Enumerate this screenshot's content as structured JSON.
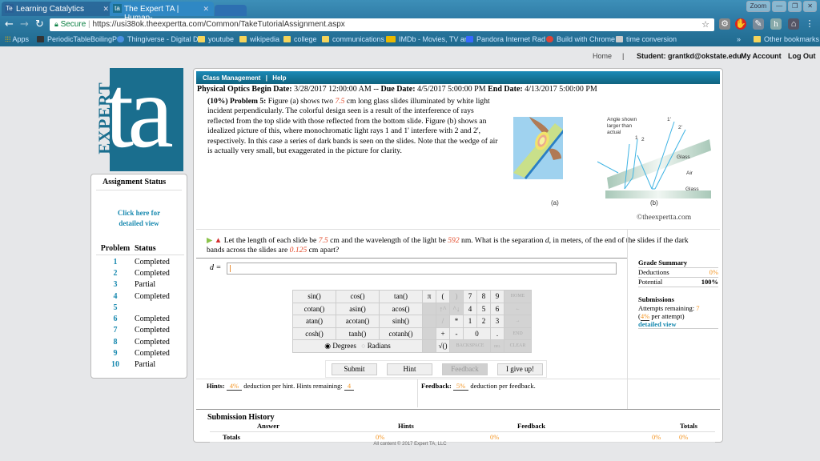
{
  "browser": {
    "tabs": [
      {
        "icon": "Te",
        "label": "Learning Catalytics"
      },
      {
        "icon": "ta",
        "label": "The Expert TA | Human-"
      }
    ],
    "window_controls": [
      "Zoom",
      "—",
      "❐",
      "✕"
    ],
    "url_secure_label": "Secure",
    "url": "https://usi38ok.theexpertta.com/Common/TakeTutorialAssignment.aspx",
    "bookmarks": [
      "Apps",
      "PeriodicTableBoilingP",
      "Thingiverse - Digital D",
      "youtube",
      "wikipedia",
      "college",
      "communications",
      "IMDb - Movies, TV an",
      "Pandora Internet Rad",
      "Build with Chrome",
      "time conversion"
    ],
    "overflow": "»",
    "other_bookmarks": "Other bookmarks"
  },
  "topnav": {
    "home": "Home",
    "sep": "|",
    "student": "Student: grantkd@okstate.edu",
    "account": "My Account",
    "logout": "Log Out"
  },
  "logo": {
    "word": "EXPERT",
    "mark": "ta"
  },
  "sidebar": {
    "title": "Assignment Status",
    "detail_link_1": "Click here for",
    "detail_link_2": "detailed view",
    "col_problem": "Problem",
    "col_status": "Status",
    "problems": [
      {
        "n": "1",
        "status": "Completed"
      },
      {
        "n": "2",
        "status": "Completed"
      },
      {
        "n": "3",
        "status": "Partial"
      },
      {
        "n": "4",
        "status": "Completed"
      },
      {
        "n": "5",
        "status": ""
      },
      {
        "n": "6",
        "status": "Completed"
      },
      {
        "n": "7",
        "status": "Completed"
      },
      {
        "n": "8",
        "status": "Completed"
      },
      {
        "n": "9",
        "status": "Completed"
      },
      {
        "n": "10",
        "status": "Partial"
      }
    ]
  },
  "menubar": {
    "class_mgmt": "Class Management",
    "sep": "|",
    "help": "Help"
  },
  "assignment": {
    "name": "Physical Optics",
    "begin_label": "Begin Date:",
    "begin": "3/28/2017 12:00:00 AM",
    "dash": "--",
    "due_label": "Due Date:",
    "due": "4/5/2017 5:00:00 PM",
    "end_label": "End Date:",
    "end": "4/13/2017 5:00:00 PM"
  },
  "problem": {
    "heading": "(10%) Problem 5:",
    "text_1": "Figure (a) shows two",
    "length": "7.5",
    "text_2": "cm long glass slides illuminated by white light incident perpendicularly. The colorful design seen is a result of the interference of rays reflected from the top slide with those reflected from the bottom slide. Figure (b) shows an idealized picture of this, where monochromatic light rays 1 and 1' interfere with 2 and 2', respectively. In this case a series of dark bands is seen on the slides. Note that the wedge of air is actually very small, but exaggerated in the picture for clarity.",
    "fig_a_label": "(a)",
    "fig_b_label": "(b)",
    "fig_b_note": "Angle shown larger than actual",
    "fig_b_rays": [
      "1",
      "2",
      "1'",
      "2'"
    ],
    "fig_b_glass": "Glass",
    "fig_b_air": "Air",
    "copyright": "©theexpertta.com"
  },
  "question": {
    "t1": "Let the length of each slide be",
    "length": "7.5",
    "t2": "cm and the wavelength of the light be",
    "wavelength": "592",
    "t3": "nm. What is the separation",
    "var": "d",
    "t4": ", in meters, of the end of the slides if the dark bands across the slides are",
    "spacing": "0.125",
    "t5": "cm apart?",
    "answer_label": "d =",
    "answer_value": ""
  },
  "grade": {
    "title": "Grade Summary",
    "deductions_label": "Deductions",
    "deductions": "0%",
    "potential_label": "Potential",
    "potential": "100%",
    "submissions_title": "Submissions",
    "attempts_label": "Attempts remaining:",
    "attempts": "7",
    "per_attempt_pct": "4%",
    "per_attempt_text": "per attempt)",
    "detail": "detailed view"
  },
  "keypad": {
    "functions": [
      [
        "sin()",
        "cos()",
        "tan()"
      ],
      [
        "cotan()",
        "asin()",
        "acos()"
      ],
      [
        "atan()",
        "acotan()",
        "sinh()"
      ],
      [
        "cosh()",
        "tanh()",
        "cotanh()"
      ]
    ],
    "pi": "π",
    "lparen": "(",
    "rparen": ")",
    "up": "↑^",
    "down": "^↓",
    "slash": "/",
    "star": "*",
    "plus": "+",
    "minus": "-",
    "sqrt": "√()",
    "digits": [
      "7",
      "8",
      "9",
      "4",
      "5",
      "6",
      "1",
      "2",
      "3",
      "0",
      "."
    ],
    "home": "HOME",
    "left": "←",
    "right": "→",
    "end": "END",
    "backspace": "BACKSPACE",
    "del": "DEL",
    "clear": "CLEAR",
    "degrees": "Degrees",
    "radians": "Radians",
    "mode": "degrees"
  },
  "actions": {
    "submit": "Submit",
    "hint": "Hint",
    "feedback": "Feedback",
    "giveup": "I give up!"
  },
  "hints": {
    "label": "Hints:",
    "pct": "4%",
    "text": "deduction per hint. Hints remaining:",
    "remaining": "4",
    "fb_label": "Feedback:",
    "fb_pct": "5%",
    "fb_text": "deduction per feedback."
  },
  "history": {
    "title": "Submission History",
    "cols": [
      "Answer",
      "Hints",
      "Feedback",
      "Totals"
    ],
    "totals_label": "Totals",
    "hints_total": "0%",
    "feedback_total": "0%",
    "totals_1": "0%",
    "totals_2": "0%"
  },
  "footer": "All content © 2017 Expert TA, LLC"
}
